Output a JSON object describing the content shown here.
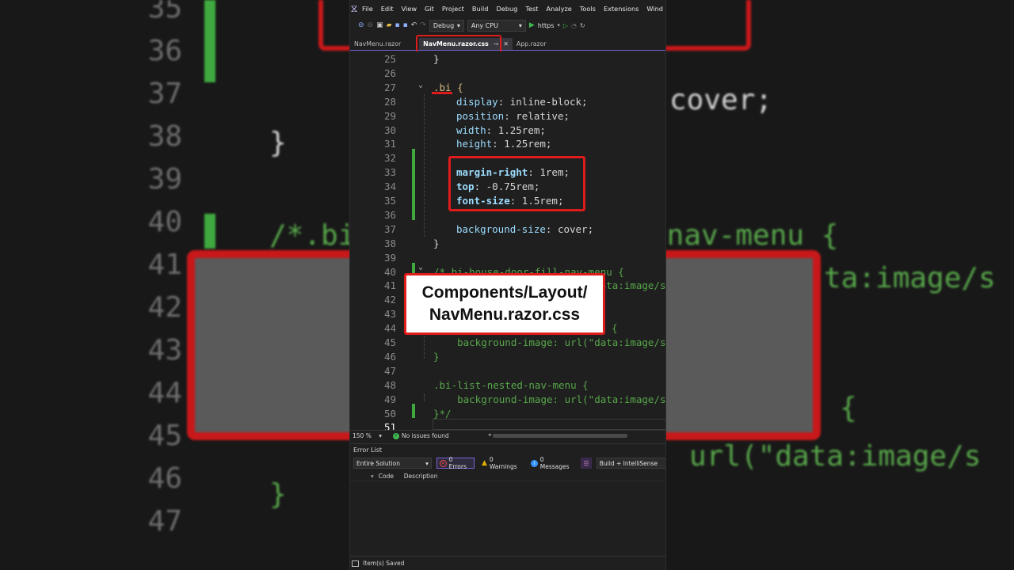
{
  "background": {
    "line_numbers": [
      "35",
      "36",
      "37",
      "38",
      "39",
      "40",
      "41",
      "42",
      "43",
      "44",
      "45",
      "46",
      "47"
    ],
    "code_fragments": [
      {
        "text": "cover;",
        "color": "#d4d4d4"
      },
      {
        "text": "}",
        "color": "#d4d4d4"
      },
      {
        "text": "/*.bi",
        "color": "#57a64a"
      },
      {
        "text": "-nav-menu {",
        "color": "#57a64a"
      },
      {
        "text": "ta:image/s",
        "color": "#57a64a"
      },
      {
        "text": "{",
        "color": "#57a64a"
      },
      {
        "text": "url(\"data:image/s",
        "color": "#57a64a"
      },
      {
        "text": "}",
        "color": "#57a64a"
      }
    ],
    "label_line1": "Comp         out/",
    "label_line2": "Nav                   css"
  },
  "menubar": {
    "items": [
      "File",
      "Edit",
      "View",
      "Git",
      "Project",
      "Build",
      "Debug",
      "Test",
      "Analyze",
      "Tools",
      "Extensions",
      "Wind"
    ]
  },
  "toolbar": {
    "config": "Debug",
    "platform": "Any CPU",
    "run_target": "https"
  },
  "tabs": [
    {
      "label": "NavMenu.razor",
      "active": false
    },
    {
      "label": "NavMenu.razor.css",
      "active": true,
      "pin": "⊸",
      "close": "✕"
    },
    {
      "label": "App.razor",
      "active": false
    }
  ],
  "editor": {
    "lines": [
      {
        "n": "25",
        "text": "}"
      },
      {
        "n": "26",
        "text": ""
      },
      {
        "n": "27",
        "text": ".bi {"
      },
      {
        "n": "28",
        "prop": "display",
        "value": "inline-block;"
      },
      {
        "n": "29",
        "prop": "position",
        "value": "relative;"
      },
      {
        "n": "30",
        "prop": "width",
        "value": "1.25rem;"
      },
      {
        "n": "31",
        "prop": "height",
        "value": "1.25rem;"
      },
      {
        "n": "32",
        "text": ""
      },
      {
        "n": "33",
        "prop": "margin-right",
        "value": "1rem;"
      },
      {
        "n": "34",
        "prop": "top",
        "value": "-0.75rem;"
      },
      {
        "n": "35",
        "prop": "font-size",
        "value": "1.5rem;"
      },
      {
        "n": "36",
        "text": ""
      },
      {
        "n": "37",
        "prop": "background-size",
        "value": "cover;"
      },
      {
        "n": "38",
        "text": "}"
      },
      {
        "n": "39",
        "text": ""
      },
      {
        "n": "40",
        "text": "/*.bi-house-door-fill-nav-menu {"
      },
      {
        "n": "41",
        "text": "    background-image: url(\"data:image/s"
      },
      {
        "n": "42",
        "text": ""
      },
      {
        "n": "43",
        "text": ""
      },
      {
        "n": "44",
        "text": "{"
      },
      {
        "n": "45",
        "text": "    background-image: url(\"data:image/s"
      },
      {
        "n": "46",
        "text": "}"
      },
      {
        "n": "47",
        "text": ""
      },
      {
        "n": "48",
        "text": ".bi-list-nested-nav-menu {"
      },
      {
        "n": "49",
        "text": "    background-image: url(\"data:image/s"
      },
      {
        "n": "50",
        "text": "}*/"
      },
      {
        "n": "51",
        "text": ""
      }
    ]
  },
  "overlay": {
    "line1": "Components/Layout/",
    "line2": "NavMenu.razor.css"
  },
  "status": {
    "zoom": "150 %",
    "issues": "No issues found"
  },
  "error_list": {
    "title": "Error List",
    "scope": "Entire Solution",
    "errors": "0 Errors",
    "warnings": "0 Warnings",
    "messages": "0 Messages",
    "build_filter": "Build + IntelliSense",
    "col_code": "Code",
    "col_description": "Description"
  },
  "bottom_status": "Item(s) Saved",
  "colors": {
    "highlight_red": "#e01b1b",
    "accent_purple": "#7c61d8",
    "css_property": "#9cdcfe",
    "css_selector": "#d7ba7d",
    "comment_green": "#57a64a",
    "change_bar": "#3fa93f"
  }
}
